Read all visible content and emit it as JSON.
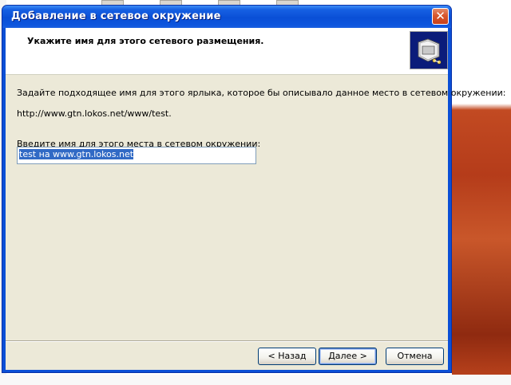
{
  "window": {
    "title": "Добавление в сетевое окружение",
    "close_label": "✕"
  },
  "header": {
    "title": "Укажите имя для этого сетевого размещения.",
    "icon": "network-folder-icon"
  },
  "body": {
    "instruction": "Задайте подходящее имя для этого ярлыка, которое бы описывало данное место в сетевом окружении:",
    "url": "http://www.gtn.lokos.net/www/test.",
    "name_label": "Введите имя для этого места в сетевом окружении:",
    "name_value": "test на www.gtn.lokos.net"
  },
  "buttons": {
    "back": "< Назад",
    "next": "Далее >",
    "cancel": "Отмена"
  },
  "colors": {
    "titlebar": "#0a4fd6",
    "client": "#ece9d8",
    "selection": "#316ac5",
    "close": "#d8572e"
  }
}
